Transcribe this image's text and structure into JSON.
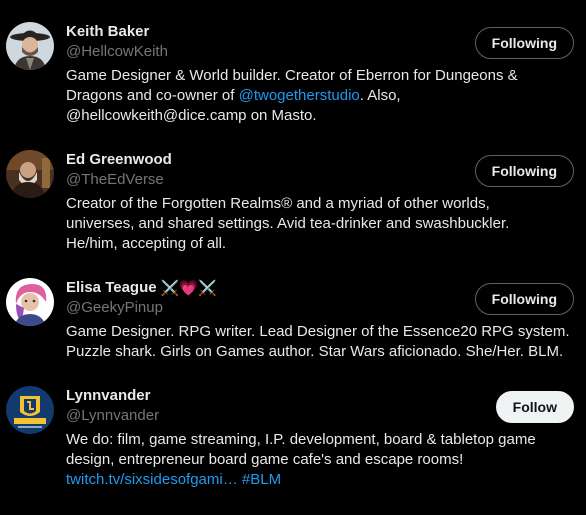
{
  "users": [
    {
      "name": "Keith Baker",
      "handle": "@HellcowKeith",
      "button": "Following",
      "bio": {
        "line1": "Game Designer & World builder. Creator of Eberron for Dungeons &",
        "line2_pre": "Dragons and co-owner of ",
        "line2_link": "@twogetherstudio",
        "line2_post": ". Also,",
        "line3": "@hellcowkeith@dice.camp on Masto."
      }
    },
    {
      "name": "Ed Greenwood",
      "handle": "@TheEdVerse",
      "button": "Following",
      "bio": {
        "line1": "Creator of the Forgotten Realms® and a myriad of other worlds,",
        "line2": "universes, and shared settings. Avid tea-drinker and swashbuckler.",
        "line3": "He/him, accepting of all."
      }
    },
    {
      "name": "Elisa Teague",
      "name_emoji": "⚔️💗⚔️",
      "handle": "@GeekyPinup",
      "button": "Following",
      "bio": {
        "line1": "Game Designer. RPG writer. Lead Designer of the Essence20 RPG system.",
        "line2": "Puzzle shark. Girls on Games author. Star Wars aficionado. She/Her. BLM."
      }
    },
    {
      "name": "Lynnvander",
      "handle": "@Lynnvander",
      "button": "Follow",
      "bio": {
        "line1": "We do: film, game streaming, I.P. development, board & tabletop game",
        "line2": "design, entrepreneur board game cafe's and escape rooms!",
        "line3_link": "twitch.tv/sixsidesofgami…",
        "line3_hashtag": "#BLM"
      }
    }
  ],
  "colors": {
    "background": "#000000",
    "text": "#e7e9ea",
    "secondary": "#71767b",
    "link": "#1d9bf0",
    "follow_bg": "#eff3f4"
  },
  "icons": {
    "avatar_1": "avatar-keith-baker",
    "avatar_2": "avatar-ed-greenwood",
    "avatar_3": "avatar-elisa-teague",
    "avatar_4": "avatar-lynnvander-logo"
  }
}
